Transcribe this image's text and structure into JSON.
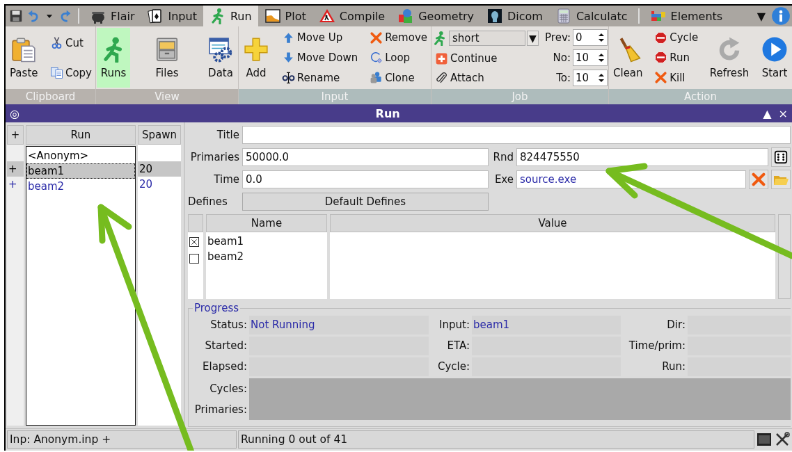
{
  "quick_access": [
    {
      "kind": "save"
    },
    {
      "kind": "undo"
    },
    {
      "kind": "caret"
    },
    {
      "kind": "redo"
    }
  ],
  "tabs": [
    {
      "label": "Flair",
      "kind": "cauldron",
      "selected": false
    },
    {
      "label": "Input",
      "kind": "cards",
      "selected": false
    },
    {
      "label": "Run",
      "kind": "runner",
      "selected": true
    },
    {
      "label": "Plot",
      "kind": "chart",
      "selected": false
    },
    {
      "label": "Compile",
      "kind": "warning",
      "selected": false
    },
    {
      "label": "Geometry",
      "kind": "shapes",
      "selected": false
    },
    {
      "label": "Dicom",
      "kind": "xray",
      "selected": false
    },
    {
      "label": "Calculatc",
      "kind": "calculator",
      "selected": false
    },
    {
      "label": "Elements",
      "kind": "elements",
      "selected": false
    }
  ],
  "tab_menu_glyph": "▼",
  "ribbon": {
    "groups": [
      {
        "label": "Clipboard",
        "color": "#b7b2ad",
        "columns": [
          [
            {
              "kind": "paste",
              "label": "Paste"
            }
          ],
          [
            {
              "kind": "cut",
              "label": "Cut"
            },
            {
              "kind": "copy",
              "label": "Copy"
            }
          ]
        ]
      },
      {
        "label": "View",
        "color": "#b7b2ad",
        "columns": [
          [
            {
              "kind": "runner",
              "label": "Runs",
              "selected": true
            }
          ],
          [
            {
              "kind": "cabinet",
              "label": "Files",
              "selected": false
            }
          ],
          [
            {
              "kind": "data",
              "label": "Data",
              "selected": false
            }
          ]
        ]
      },
      {
        "label": "Input",
        "color": "#aebcbc",
        "columns": [
          [
            {
              "kind": "plus",
              "label": "Add"
            }
          ],
          [
            {
              "kind": "up",
              "label": "Move Up"
            },
            {
              "kind": "down",
              "label": "Move Down"
            },
            {
              "kind": "rename",
              "label": "Rename"
            }
          ],
          [
            {
              "kind": "remove",
              "label": "Remove"
            },
            {
              "kind": "loop",
              "label": "Loop"
            },
            {
              "kind": "clone",
              "label": "Clone"
            }
          ]
        ]
      },
      {
        "label": "Job",
        "color": "#aebcbc",
        "columns": [
          [
            {
              "kind": "combo",
              "value": "short",
              "glyph": "▼"
            },
            {
              "kind": "continue",
              "label": "Continue"
            },
            {
              "kind": "attach",
              "label": "Attach"
            }
          ],
          [
            {
              "kind": "spin",
              "label": "Prev:",
              "value": "0"
            },
            {
              "kind": "spin",
              "label": "No:",
              "value": "10"
            },
            {
              "kind": "spin",
              "label": "To:",
              "value": "10"
            }
          ]
        ]
      },
      {
        "label": "Action",
        "color": "#aebcbc",
        "columns": [
          [
            {
              "kind": "broom",
              "label": "Clean"
            }
          ],
          [
            {
              "kind": "stop",
              "label": "Cycle"
            },
            {
              "kind": "stop",
              "label": "Run"
            },
            {
              "kind": "remove",
              "label": "Kill"
            }
          ],
          [
            {
              "kind": "refresh",
              "label": "Refresh"
            }
          ],
          [
            {
              "kind": "start",
              "label": "Start"
            }
          ]
        ]
      }
    ]
  },
  "panel": {
    "menu_glyph": "◎",
    "title": "Run",
    "buttons": [
      "▲",
      "×"
    ]
  },
  "run_list": {
    "add_glyph": "+",
    "columns": [
      "Run",
      "Spawn"
    ],
    "rows": [
      {
        "name": "<Anonym>",
        "selected": false,
        "color": "#000000"
      },
      {
        "mark": "+",
        "name": "beam1",
        "spawn": "20",
        "selected": true,
        "color": "#000000"
      },
      {
        "mark": "+",
        "name": "beam2",
        "spawn": "20",
        "selected": false,
        "color": "#2a2aa8"
      }
    ]
  },
  "form": {
    "title": {
      "label": "Title"
    },
    "primaries": {
      "label": "Primaries",
      "value": "50000.0"
    },
    "rnd": {
      "label": "Rnd",
      "value": "824475550"
    },
    "time": {
      "label": "Time",
      "value": "0.0"
    },
    "exe": {
      "label": "Exe",
      "value": "source.exe"
    },
    "defines": {
      "label": "Defines",
      "button": "Default Defines"
    }
  },
  "defines_table": {
    "columns": [
      "Name",
      "Value"
    ],
    "rows": [
      {
        "name": "beam1",
        "checked": true
      },
      {
        "name": "beam2",
        "checked": false
      }
    ]
  },
  "progress": {
    "legend": "Progress",
    "fields": [
      {
        "label": "Status:",
        "value": "Not Running"
      },
      {
        "label": "Input:",
        "value": "beam1"
      },
      {
        "label": "Dir:"
      },
      {
        "label": "Started:"
      },
      {
        "label": "ETA:"
      },
      {
        "label": "Time/prim:"
      },
      {
        "label": "Elapsed:"
      },
      {
        "label": "Cycle:"
      },
      {
        "label": "Run:"
      }
    ],
    "bars": [
      {
        "label": "Cycles:",
        "level": 0
      },
      {
        "label": "Primaries:",
        "level": 0
      }
    ]
  },
  "status_bar": {
    "segments": [
      "Inp: Anonym.inp +",
      "Running 0 out of 41"
    ],
    "icons": [
      {
        "kind": "terminal"
      },
      {
        "kind": "tools"
      }
    ]
  }
}
